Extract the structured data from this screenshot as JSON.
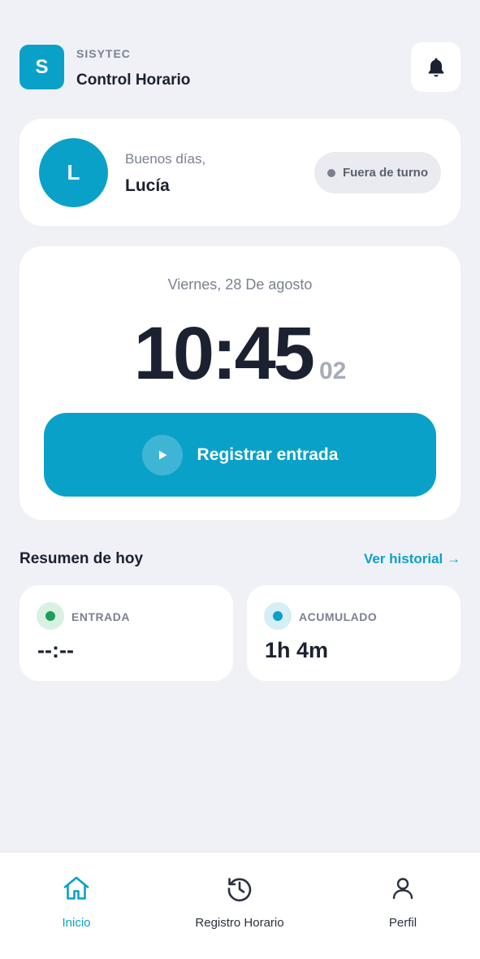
{
  "header": {
    "logo_letter": "S",
    "brand": "SISYTEC",
    "title": "Control Horario",
    "notification_icon": "bell-icon"
  },
  "greeting": {
    "avatar_letter": "L",
    "salutation": "Buenos días,",
    "name": "Lucía",
    "status": "Fuera de turno"
  },
  "clock": {
    "date": "Viernes, 28 De agosto",
    "time": "10:45",
    "seconds": "02",
    "register_button": "Registrar entrada",
    "register_icon": "play-icon"
  },
  "summary": {
    "title": "Resumen de hoy",
    "history_link": "Ver historial →",
    "entry": {
      "label": "ENTRADA",
      "value": "--:--",
      "color": "#1e9e5a"
    },
    "accumulated": {
      "label": "ACUMULADO",
      "value": "1h 4m",
      "color": "#0aa1c9"
    }
  },
  "nav": {
    "items": [
      {
        "label": "Inicio",
        "icon": "home-icon",
        "active": true
      },
      {
        "label": "Registro Horario",
        "icon": "history-icon",
        "active": false
      },
      {
        "label": "Perfil",
        "icon": "user-icon",
        "active": false
      }
    ]
  },
  "colors": {
    "accent": "#0aa1c9",
    "background": "#eff1f6",
    "text": "#1b2130",
    "muted": "#7b8191"
  }
}
